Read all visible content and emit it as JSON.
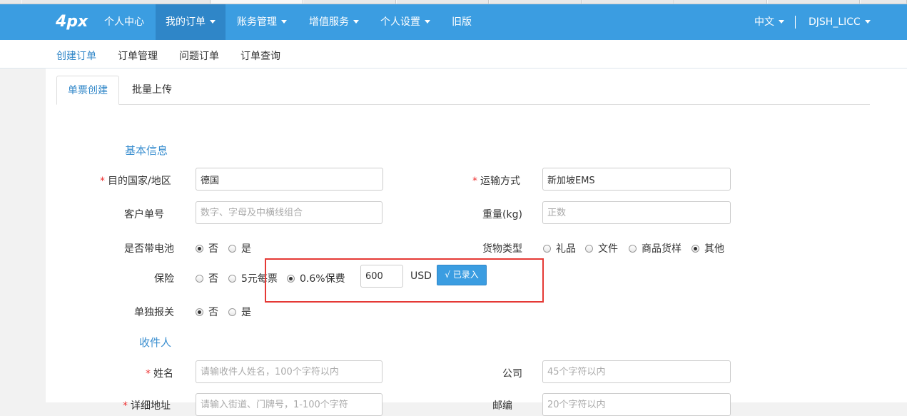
{
  "nav": {
    "logo": "4px",
    "items": [
      "个人中心",
      "我的订单",
      "账务管理",
      "增值服务",
      "个人设置",
      "旧版"
    ],
    "language": "中文",
    "user": "DJSH_LICC"
  },
  "subnav": {
    "items": [
      "创建订单",
      "订单管理",
      "问题订单",
      "订单查询"
    ]
  },
  "tabs": {
    "single": "单票创建",
    "batch": "批量上传"
  },
  "basic_info": {
    "title": "基本信息",
    "destination_label": "目的国家/地区",
    "destination_value": "德国",
    "shipping_label": "运输方式",
    "shipping_value": "新加坡EMS",
    "customer_no_label": "客户单号",
    "customer_no_placeholder": "数字、字母及中横线组合",
    "weight_label": "重量(kg)",
    "weight_placeholder": "正数",
    "battery_label": "是否带电池",
    "battery_options": [
      "否",
      "是"
    ],
    "cargo_label": "货物类型",
    "cargo_options": [
      "礼品",
      "文件",
      "商品货样",
      "其他"
    ],
    "insurance_label": "保险",
    "insurance_options": [
      "否",
      "5元每票",
      "0.6%保费"
    ],
    "insurance_amount": "600",
    "insurance_currency": "USD",
    "recorded_button": "√ 已录入",
    "customs_label": "单独报关",
    "customs_options": [
      "否",
      "是"
    ]
  },
  "recipient": {
    "title": "收件人",
    "name_label": "姓名",
    "name_placeholder": "请输收件人姓名，100个字符以内",
    "company_label": "公司",
    "company_placeholder": "45个字符以内",
    "address_label": "详细地址",
    "address_placeholder": "请输入街道、门牌号，1-100个字符",
    "zip_label": "邮编",
    "zip_placeholder": "20个字符以内"
  }
}
